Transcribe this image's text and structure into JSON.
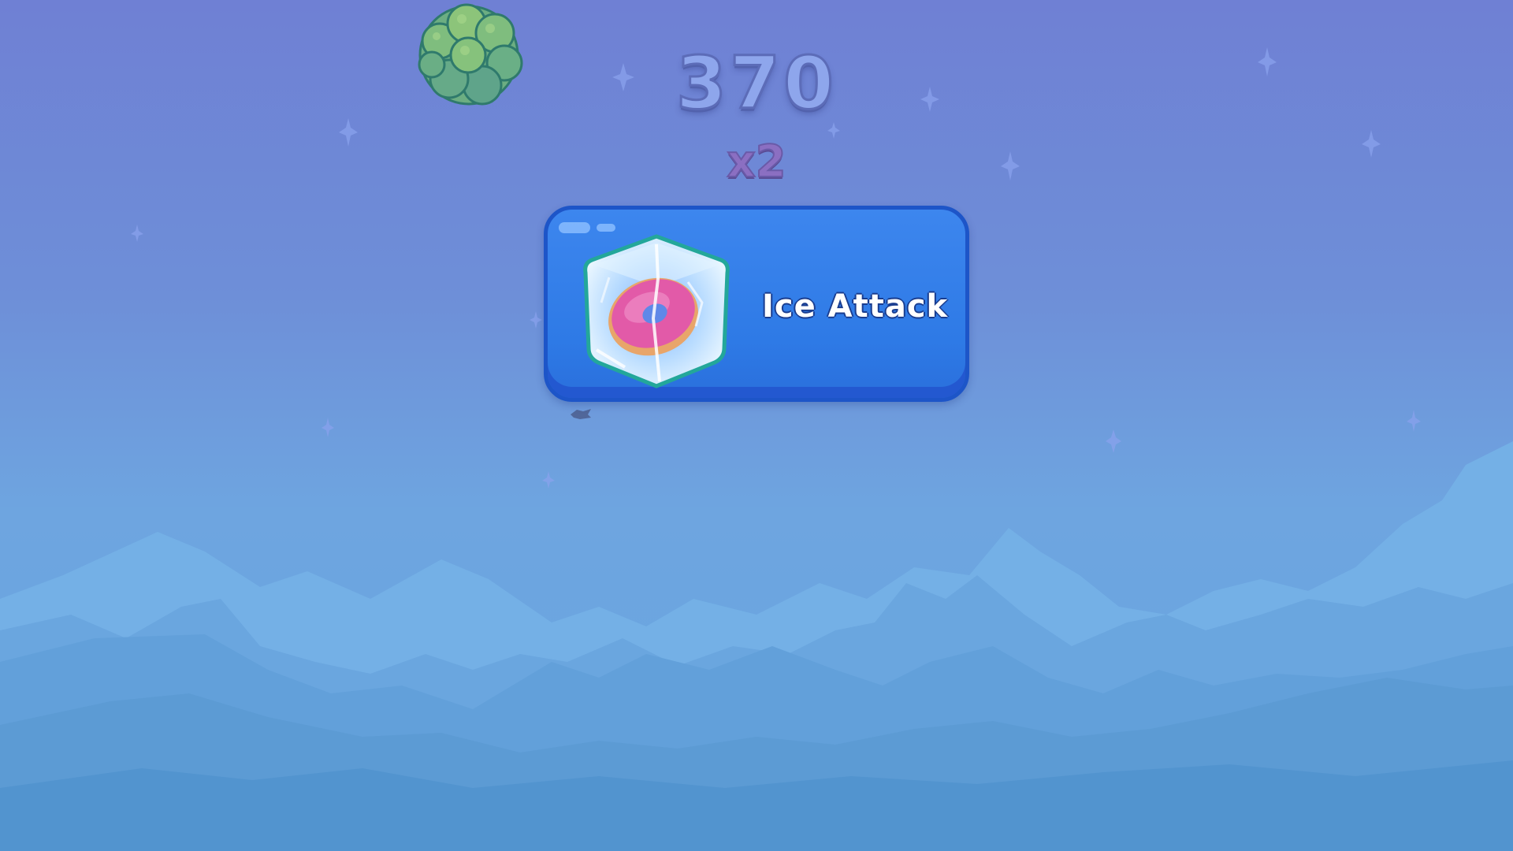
{
  "hud": {
    "score": "370",
    "multiplier": "x2"
  },
  "powerup": {
    "label": "Ice Attack",
    "icon": "frozen-donut-icon"
  },
  "scene": {
    "falling_item_icon": "broccoli-icon",
    "background": "night-sky-mountains",
    "colors": {
      "sky_top": "#6f80d4",
      "sky_bottom": "#66a6e0",
      "banner_fill": "#2e7ae6",
      "banner_border": "#1d55c8",
      "score_text": "#8ea6ec",
      "multiplier_text": "#8b6fc2"
    }
  }
}
